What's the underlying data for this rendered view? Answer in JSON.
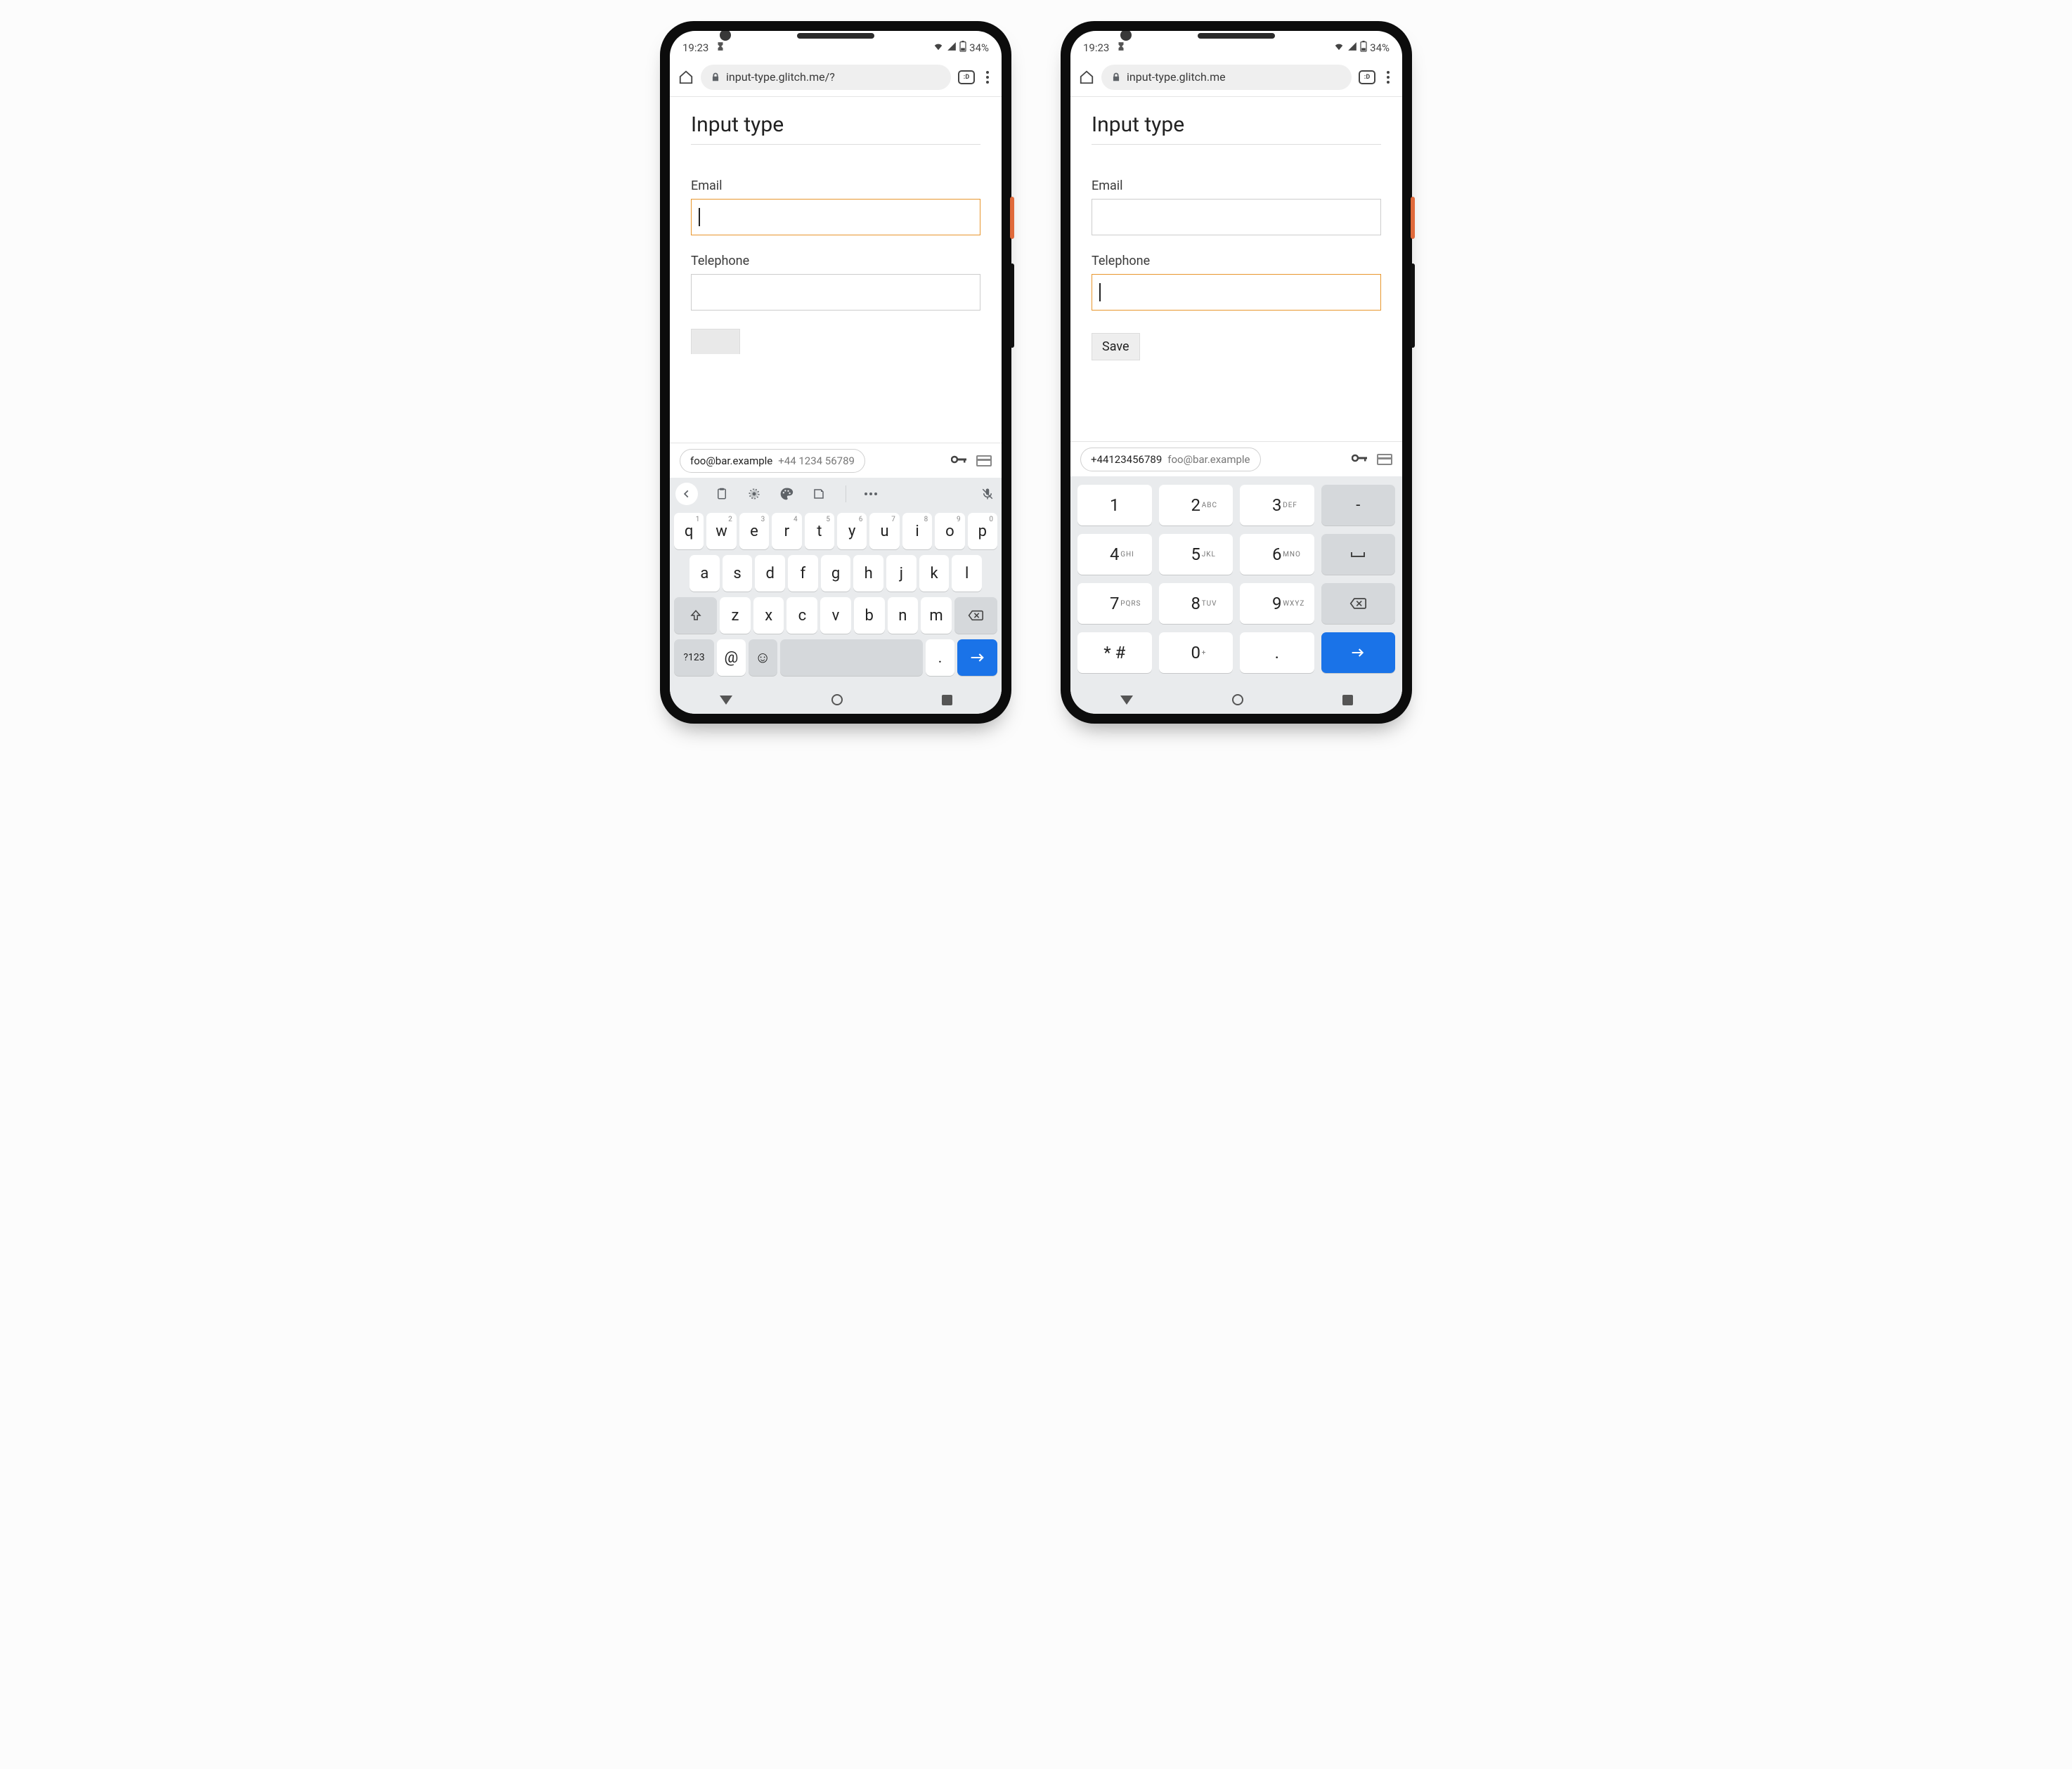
{
  "status": {
    "time": "19:23",
    "battery": "34%"
  },
  "left_phone": {
    "url": "input-type.glitch.me/?",
    "tabs_badge": ":D",
    "page_title": "Input type",
    "email_label": "Email",
    "tel_label": "Telephone",
    "focused": "email",
    "autofill": {
      "primary": "foo@bar.example",
      "secondary": "+44 1234 56789"
    },
    "qwerty": {
      "row1": [
        [
          "q",
          "1"
        ],
        [
          "w",
          "2"
        ],
        [
          "e",
          "3"
        ],
        [
          "r",
          "4"
        ],
        [
          "t",
          "5"
        ],
        [
          "y",
          "6"
        ],
        [
          "u",
          "7"
        ],
        [
          "i",
          "8"
        ],
        [
          "o",
          "9"
        ],
        [
          "p",
          "0"
        ]
      ],
      "row2": [
        "a",
        "s",
        "d",
        "f",
        "g",
        "h",
        "j",
        "k",
        "l"
      ],
      "row3": [
        "z",
        "x",
        "c",
        "v",
        "b",
        "n",
        "m"
      ],
      "sym_key": "?123",
      "at_key": "@",
      "period_key": "."
    }
  },
  "right_phone": {
    "url": "input-type.glitch.me",
    "tabs_badge": ":D",
    "page_title": "Input type",
    "email_label": "Email",
    "tel_label": "Telephone",
    "focused": "tel",
    "save_label": "Save",
    "autofill": {
      "primary": "+44123456789",
      "secondary": "foo@bar.example"
    },
    "numpad": {
      "rows": [
        [
          [
            "1",
            ""
          ],
          [
            "2",
            "ABC"
          ],
          [
            "3",
            "DEF"
          ]
        ],
        [
          [
            "4",
            "GHI"
          ],
          [
            "5",
            "JKL"
          ],
          [
            "6",
            "MNO"
          ]
        ],
        [
          [
            "7",
            "PQRS"
          ],
          [
            "8",
            "TUV"
          ],
          [
            "9",
            "WXYZ"
          ]
        ],
        [
          [
            "* #",
            ""
          ],
          [
            "0",
            "+"
          ],
          [
            ".",
            ""
          ]
        ]
      ],
      "side": [
        "-",
        "␣",
        "⌫",
        "→"
      ]
    }
  }
}
